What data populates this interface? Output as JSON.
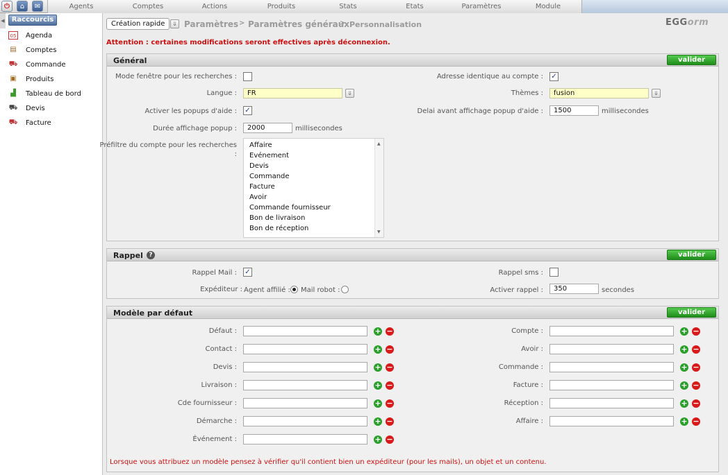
{
  "topbar": {
    "icons": [
      "power-icon",
      "home-icon",
      "mail-icon"
    ],
    "menu": [
      "Agents",
      "Comptes",
      "Actions",
      "Produits",
      "Stats",
      "Etats",
      "Paramètres",
      "Module"
    ]
  },
  "sidebar": {
    "title": "Raccourcis",
    "items": [
      {
        "label": "Agenda",
        "icon": "calendar-icon"
      },
      {
        "label": "Comptes",
        "icon": "accounts-icon"
      },
      {
        "label": "Commande",
        "icon": "order-icon"
      },
      {
        "label": "Produits",
        "icon": "products-icon"
      },
      {
        "label": "Tableau de bord",
        "icon": "dashboard-icon"
      },
      {
        "label": "Devis",
        "icon": "quote-icon"
      },
      {
        "label": "Facture",
        "icon": "invoice-icon"
      }
    ]
  },
  "header": {
    "quick_create": "Création rapide",
    "crumbs": [
      "Paramètres",
      ">",
      "Paramètres généraux",
      ">",
      "Personnalisation"
    ],
    "logo_main": "EGG",
    "logo_suffix": "orm",
    "warning": "Attention : certaines modifications seront effectives après déconnexion."
  },
  "general": {
    "title": "Général",
    "validate": "valider",
    "search_window_label": "Mode fenêtre pour les recherches :",
    "search_window_checked": false,
    "same_address_label": "Adresse identique au compte :",
    "same_address_checked": true,
    "language_label": "Langue :",
    "language_value": "FR",
    "themes_label": "Thèmes :",
    "themes_value": "fusion",
    "popups_label": "Activer les popups d'aide :",
    "popups_checked": true,
    "delay_label": "Delai avant affichage popup d'aide :",
    "delay_value": "1500",
    "delay_unit": "millisecondes",
    "duration_label": "Durée affichage popup :",
    "duration_value": "2000",
    "duration_unit": "millisecondes",
    "prefilter_label_1": "Préfiltre du compte pour les recherches",
    "prefilter_label_2": ":",
    "prefilter_options": [
      "Affaire",
      "Evénement",
      "Devis",
      "Commande",
      "Facture",
      "Avoir",
      "Commande fournisseur",
      "Bon de livraison",
      "Bon de réception"
    ]
  },
  "reminder": {
    "title": "Rappel",
    "validate": "valider",
    "mail_label": "Rappel Mail :",
    "mail_checked": true,
    "sms_label": "Rappel sms :",
    "sms_checked": false,
    "sender_label": "Expéditeur :",
    "agent_option": "Agent affilié :",
    "robot_option": "Mail robot :",
    "selected_sender": "Agent affilié",
    "activate_label": "Activer rappel :",
    "activate_value": "350",
    "activate_unit": "secondes"
  },
  "templates": {
    "title": "Modèle par défaut",
    "validate": "valider",
    "left": [
      "Défaut :",
      "Contact :",
      "Devis :",
      "Livraison :",
      "Cde fournisseur :",
      "Démarche :",
      "Événement :"
    ],
    "right": [
      "Compte :",
      "Avoir :",
      "Commande :",
      "Facture :",
      "Réception :",
      "Affaire :"
    ],
    "note": "Lorsque vous attribuez un modèle pensez à vérifier qu'il contient bien un expéditeur (pour les mails), un objet et un contenu."
  }
}
